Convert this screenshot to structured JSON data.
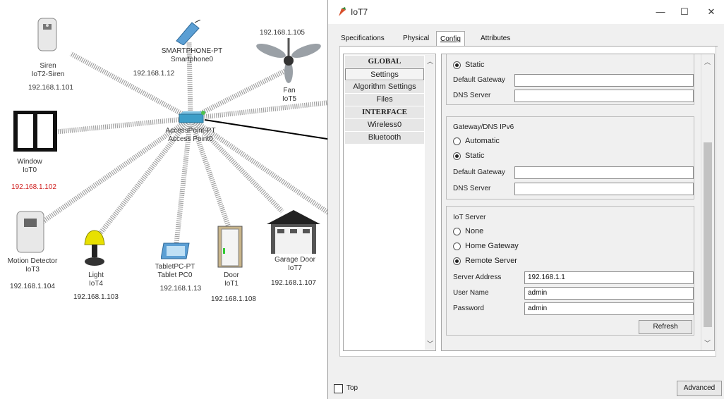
{
  "workspace": {
    "devices": {
      "siren": {
        "type": "Siren",
        "name": "IoT2-Siren",
        "ip": "192.168.1.101"
      },
      "smartphone": {
        "type": "SMARTPHONE-PT",
        "name": "Smartphone0",
        "ip": "192.168.1.12"
      },
      "fan": {
        "type": "Fan",
        "name": "IoT5",
        "ip": "192.168.1.105"
      },
      "window": {
        "type": "Window",
        "name": "IoT0",
        "ip": "192.168.1.102"
      },
      "access_point": {
        "type": "AccessPoint-PT",
        "name": "Access Point0"
      },
      "motion": {
        "type": "Motion Detector",
        "name": "IoT3",
        "ip": "192.168.1.104"
      },
      "light": {
        "type": "Light",
        "name": "IoT4",
        "ip": "192.168.1.103"
      },
      "tablet": {
        "type": "TabletPC-PT",
        "name": "Tablet PC0",
        "ip": "192.168.1.13"
      },
      "door": {
        "type": "Door",
        "name": "IoT1",
        "ip": "192.168.1.108"
      },
      "garage": {
        "type": "Garage Door",
        "name": "IoT7",
        "ip": "192.168.1.107"
      }
    },
    "colors": {
      "link": "#9a9a9a",
      "error_ip": "#d02020",
      "ap": "#3d9ec8"
    }
  },
  "dialog": {
    "title": "IoT7",
    "window_controls": {
      "minimize": "—",
      "maximize": "☐",
      "close": "✕"
    },
    "tabs": [
      {
        "label": "Specifications",
        "active": false
      },
      {
        "label": "Physical",
        "active": false
      },
      {
        "label": "Config",
        "active": true
      },
      {
        "label": "Attributes",
        "active": false
      }
    ],
    "nav": {
      "global_header": "GLOBAL",
      "items": [
        "Settings",
        "Algorithm Settings",
        "Files"
      ],
      "interface_header": "INTERFACE",
      "interfaces": [
        "Wireless0",
        "Bluetooth"
      ],
      "selected": "Settings"
    },
    "gateway_ipv4": {
      "static_label": "Static",
      "default_gateway_label": "Default Gateway",
      "default_gateway_value": "",
      "dns_server_label": "DNS Server",
      "dns_server_value": ""
    },
    "gateway_ipv6": {
      "title": "Gateway/DNS IPv6",
      "automatic_label": "Automatic",
      "static_label": "Static",
      "selected": "Static",
      "default_gateway_label": "Default Gateway",
      "default_gateway_value": "",
      "dns_server_label": "DNS Server",
      "dns_server_value": ""
    },
    "iot_server": {
      "title": "IoT Server",
      "options": [
        "None",
        "Home Gateway",
        "Remote Server"
      ],
      "selected": "Remote Server",
      "server_address_label": "Server Address",
      "server_address_value": "192.168.1.1",
      "user_name_label": "User Name",
      "user_name_value": "admin",
      "password_label": "Password",
      "password_value": "admin",
      "refresh_label": "Refresh"
    },
    "footer": {
      "top_label": "Top",
      "top_checked": false,
      "advanced_label": "Advanced"
    }
  }
}
